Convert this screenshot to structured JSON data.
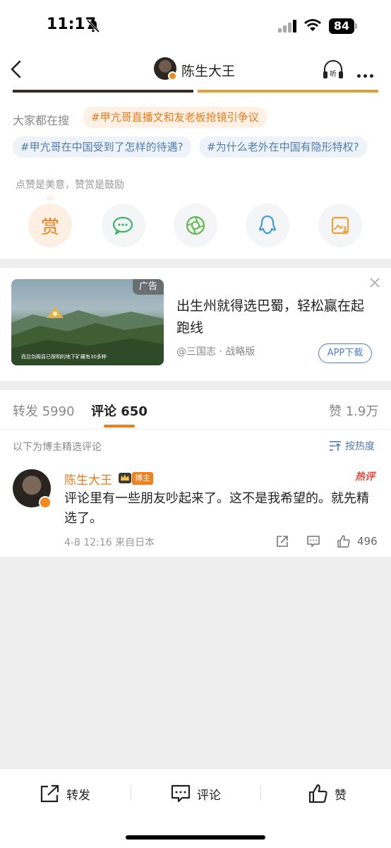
{
  "status_bar": {
    "time": "11:17",
    "battery": "84"
  },
  "nav": {
    "title": "陈生大王"
  },
  "search": {
    "label": "大家都在搜",
    "hot_tag": "#甲亢哥直播文和友老板抢镜引争议",
    "tags": [
      "#甲亢哥在中国受到了怎样的待遇?",
      "#为什么老外在中国有隐形特权?"
    ]
  },
  "reward": {
    "hint": "点赞是美意，赞赏是鼓励",
    "reward_label": "赏",
    "share_targets": [
      "wechat-icon",
      "moments-icon",
      "qq-icon",
      "save-image-icon"
    ]
  },
  "ad": {
    "badge": "广告",
    "title": "出生州就得选巴蜀，轻松赢在起跑线",
    "source": "@三国志 · 战略版",
    "button": "APP下载",
    "image_caption": "而且剑阁县已探明的地下矿藏有30多种"
  },
  "tabs": {
    "repost": "转发 5990",
    "comment": "评论 650",
    "like": "赞 1.9万"
  },
  "comments_header": {
    "hint": "以下为博主精选评论",
    "sort": "按热度"
  },
  "comment": {
    "name": "陈生大王",
    "owner_badge": "博主",
    "hot_badge": "热评",
    "text": "评论里有一些朋友吵起来了。这不是我希望的。就先精选了。",
    "meta": "4-8 12:16  来自日本",
    "likes": "496"
  },
  "bottom_bar": {
    "repost": "转发",
    "comment": "评论",
    "like": "赞"
  },
  "colors": {
    "accent": "#ef7d1c",
    "link": "#507daf",
    "ad_button": "#4a7fd0"
  }
}
